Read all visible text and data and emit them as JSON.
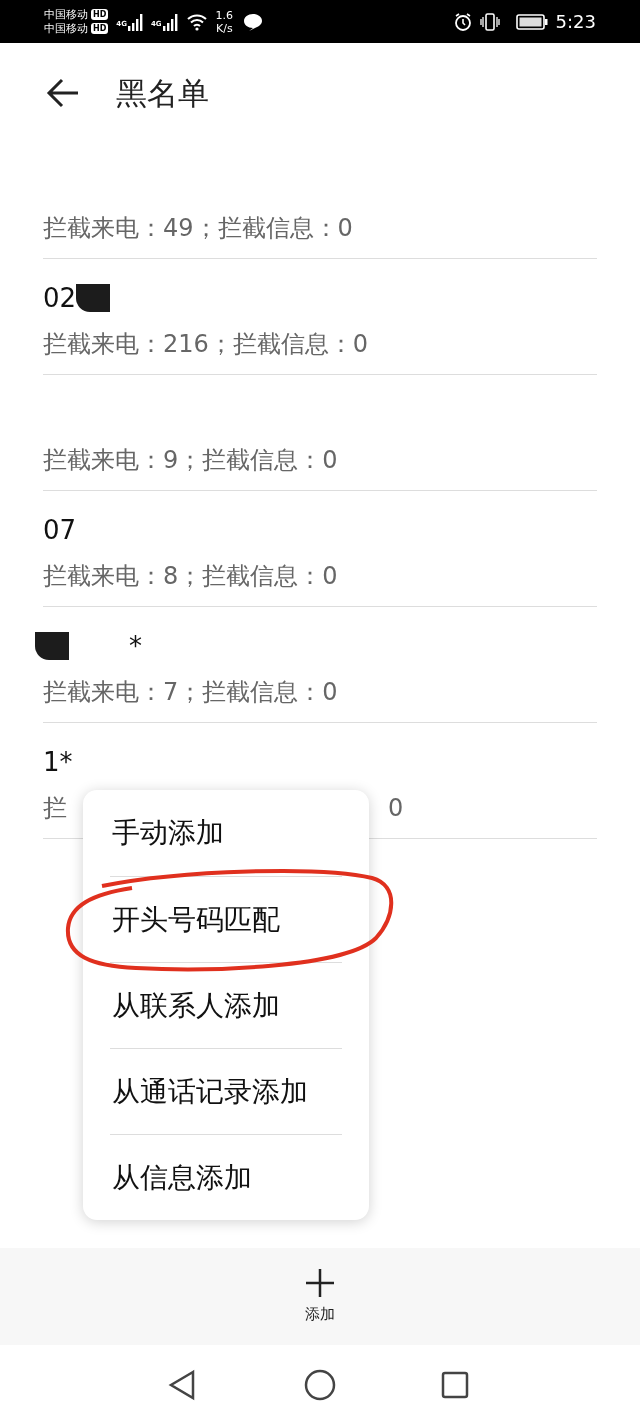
{
  "status_bar": {
    "carriers": [
      {
        "name": "中国移动",
        "badge": "HD"
      },
      {
        "name": "中国移动",
        "badge": "HD"
      }
    ],
    "network_types": [
      "4G",
      "4G"
    ],
    "speed": {
      "value": "1.6",
      "unit": "K/s"
    },
    "time": "5:23"
  },
  "header": {
    "title": "黑名单"
  },
  "entries": [
    {
      "redacted": false,
      "detail": "拦截来电：49；拦截信息：0"
    },
    {
      "number": "02",
      "redacted": true,
      "detail": "拦截来电：216；拦截信息：0"
    },
    {
      "redacted": false,
      "detail": "拦截来电：9；拦截信息：0"
    },
    {
      "number": "07",
      "redacted": false,
      "detail": "拦截来电：8；拦截信息：0"
    },
    {
      "number": "*",
      "redacted": true,
      "detail": "拦截来电：7；拦截信息：0"
    },
    {
      "number": "1*",
      "redacted": false,
      "detail": "拦",
      "detail_tail": "0"
    }
  ],
  "popup_menu": {
    "items": [
      {
        "label": "手动添加",
        "highlighted": false
      },
      {
        "label": "开头号码匹配",
        "highlighted": true
      },
      {
        "label": "从联系人添加",
        "highlighted": false
      },
      {
        "label": "从通话记录添加",
        "highlighted": false
      },
      {
        "label": "从信息添加",
        "highlighted": false
      }
    ]
  },
  "bottom_bar": {
    "add_label": "添加"
  }
}
